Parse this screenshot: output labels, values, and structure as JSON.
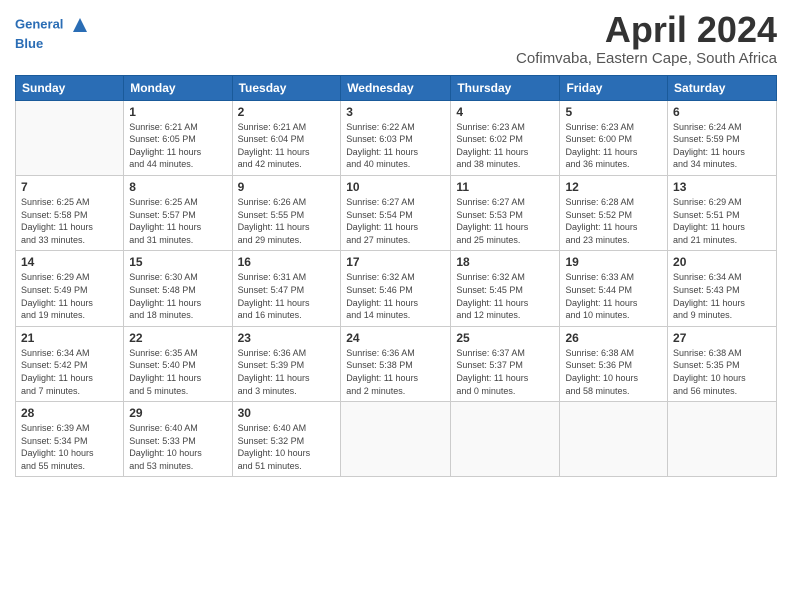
{
  "logo": {
    "line1": "General",
    "line2": "Blue"
  },
  "title": "April 2024",
  "subtitle": "Cofimvaba, Eastern Cape, South Africa",
  "days_of_week": [
    "Sunday",
    "Monday",
    "Tuesday",
    "Wednesday",
    "Thursday",
    "Friday",
    "Saturday"
  ],
  "weeks": [
    [
      {
        "day": "",
        "info": ""
      },
      {
        "day": "1",
        "info": "Sunrise: 6:21 AM\nSunset: 6:05 PM\nDaylight: 11 hours\nand 44 minutes."
      },
      {
        "day": "2",
        "info": "Sunrise: 6:21 AM\nSunset: 6:04 PM\nDaylight: 11 hours\nand 42 minutes."
      },
      {
        "day": "3",
        "info": "Sunrise: 6:22 AM\nSunset: 6:03 PM\nDaylight: 11 hours\nand 40 minutes."
      },
      {
        "day": "4",
        "info": "Sunrise: 6:23 AM\nSunset: 6:02 PM\nDaylight: 11 hours\nand 38 minutes."
      },
      {
        "day": "5",
        "info": "Sunrise: 6:23 AM\nSunset: 6:00 PM\nDaylight: 11 hours\nand 36 minutes."
      },
      {
        "day": "6",
        "info": "Sunrise: 6:24 AM\nSunset: 5:59 PM\nDaylight: 11 hours\nand 34 minutes."
      }
    ],
    [
      {
        "day": "7",
        "info": "Sunrise: 6:25 AM\nSunset: 5:58 PM\nDaylight: 11 hours\nand 33 minutes."
      },
      {
        "day": "8",
        "info": "Sunrise: 6:25 AM\nSunset: 5:57 PM\nDaylight: 11 hours\nand 31 minutes."
      },
      {
        "day": "9",
        "info": "Sunrise: 6:26 AM\nSunset: 5:55 PM\nDaylight: 11 hours\nand 29 minutes."
      },
      {
        "day": "10",
        "info": "Sunrise: 6:27 AM\nSunset: 5:54 PM\nDaylight: 11 hours\nand 27 minutes."
      },
      {
        "day": "11",
        "info": "Sunrise: 6:27 AM\nSunset: 5:53 PM\nDaylight: 11 hours\nand 25 minutes."
      },
      {
        "day": "12",
        "info": "Sunrise: 6:28 AM\nSunset: 5:52 PM\nDaylight: 11 hours\nand 23 minutes."
      },
      {
        "day": "13",
        "info": "Sunrise: 6:29 AM\nSunset: 5:51 PM\nDaylight: 11 hours\nand 21 minutes."
      }
    ],
    [
      {
        "day": "14",
        "info": "Sunrise: 6:29 AM\nSunset: 5:49 PM\nDaylight: 11 hours\nand 19 minutes."
      },
      {
        "day": "15",
        "info": "Sunrise: 6:30 AM\nSunset: 5:48 PM\nDaylight: 11 hours\nand 18 minutes."
      },
      {
        "day": "16",
        "info": "Sunrise: 6:31 AM\nSunset: 5:47 PM\nDaylight: 11 hours\nand 16 minutes."
      },
      {
        "day": "17",
        "info": "Sunrise: 6:32 AM\nSunset: 5:46 PM\nDaylight: 11 hours\nand 14 minutes."
      },
      {
        "day": "18",
        "info": "Sunrise: 6:32 AM\nSunset: 5:45 PM\nDaylight: 11 hours\nand 12 minutes."
      },
      {
        "day": "19",
        "info": "Sunrise: 6:33 AM\nSunset: 5:44 PM\nDaylight: 11 hours\nand 10 minutes."
      },
      {
        "day": "20",
        "info": "Sunrise: 6:34 AM\nSunset: 5:43 PM\nDaylight: 11 hours\nand 9 minutes."
      }
    ],
    [
      {
        "day": "21",
        "info": "Sunrise: 6:34 AM\nSunset: 5:42 PM\nDaylight: 11 hours\nand 7 minutes."
      },
      {
        "day": "22",
        "info": "Sunrise: 6:35 AM\nSunset: 5:40 PM\nDaylight: 11 hours\nand 5 minutes."
      },
      {
        "day": "23",
        "info": "Sunrise: 6:36 AM\nSunset: 5:39 PM\nDaylight: 11 hours\nand 3 minutes."
      },
      {
        "day": "24",
        "info": "Sunrise: 6:36 AM\nSunset: 5:38 PM\nDaylight: 11 hours\nand 2 minutes."
      },
      {
        "day": "25",
        "info": "Sunrise: 6:37 AM\nSunset: 5:37 PM\nDaylight: 11 hours\nand 0 minutes."
      },
      {
        "day": "26",
        "info": "Sunrise: 6:38 AM\nSunset: 5:36 PM\nDaylight: 10 hours\nand 58 minutes."
      },
      {
        "day": "27",
        "info": "Sunrise: 6:38 AM\nSunset: 5:35 PM\nDaylight: 10 hours\nand 56 minutes."
      }
    ],
    [
      {
        "day": "28",
        "info": "Sunrise: 6:39 AM\nSunset: 5:34 PM\nDaylight: 10 hours\nand 55 minutes."
      },
      {
        "day": "29",
        "info": "Sunrise: 6:40 AM\nSunset: 5:33 PM\nDaylight: 10 hours\nand 53 minutes."
      },
      {
        "day": "30",
        "info": "Sunrise: 6:40 AM\nSunset: 5:32 PM\nDaylight: 10 hours\nand 51 minutes."
      },
      {
        "day": "",
        "info": ""
      },
      {
        "day": "",
        "info": ""
      },
      {
        "day": "",
        "info": ""
      },
      {
        "day": "",
        "info": ""
      }
    ]
  ]
}
